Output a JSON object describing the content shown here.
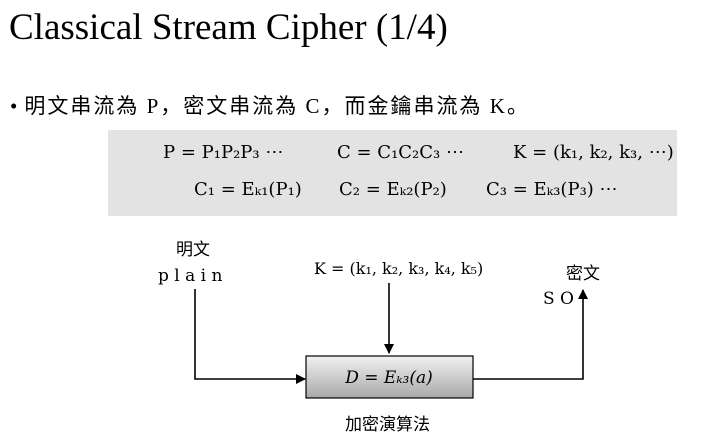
{
  "slide": {
    "title": "Classical Stream Cipher (1/4)",
    "bullet_marker": "•",
    "bullet_text": "明文串流為 P，密文串流為 C，而金鑰串流為 K。"
  },
  "formulas": {
    "p_stream": "P = P₁P₂P₃ ⋯",
    "c_stream": "C = C₁C₂C₃ ⋯",
    "k_stream": "K = (k₁, k₂, k₃, ⋯)",
    "c1": "C₁ = Eₖ₁(P₁)",
    "c2": "C₂ = Eₖ₂(P₂)",
    "c3": "C₃ = Eₖ₃(P₃) ⋯"
  },
  "diagram": {
    "plaintext_label": "明文",
    "plaintext_value": "p l a i n",
    "key_label": "K = (k₁, k₂, k₃, k₄, k₅)",
    "ciphertext_label": "密文",
    "ciphertext_value": "S O",
    "box_label": "D = Eₖ₃(a)",
    "algorithm_label": "加密演算法"
  },
  "colors": {
    "formula_box_bg": "#e3e3e3",
    "algorithm_box_gradient_top": "#f2f2f2",
    "algorithm_box_gradient_bottom": "#a8a8a8"
  }
}
